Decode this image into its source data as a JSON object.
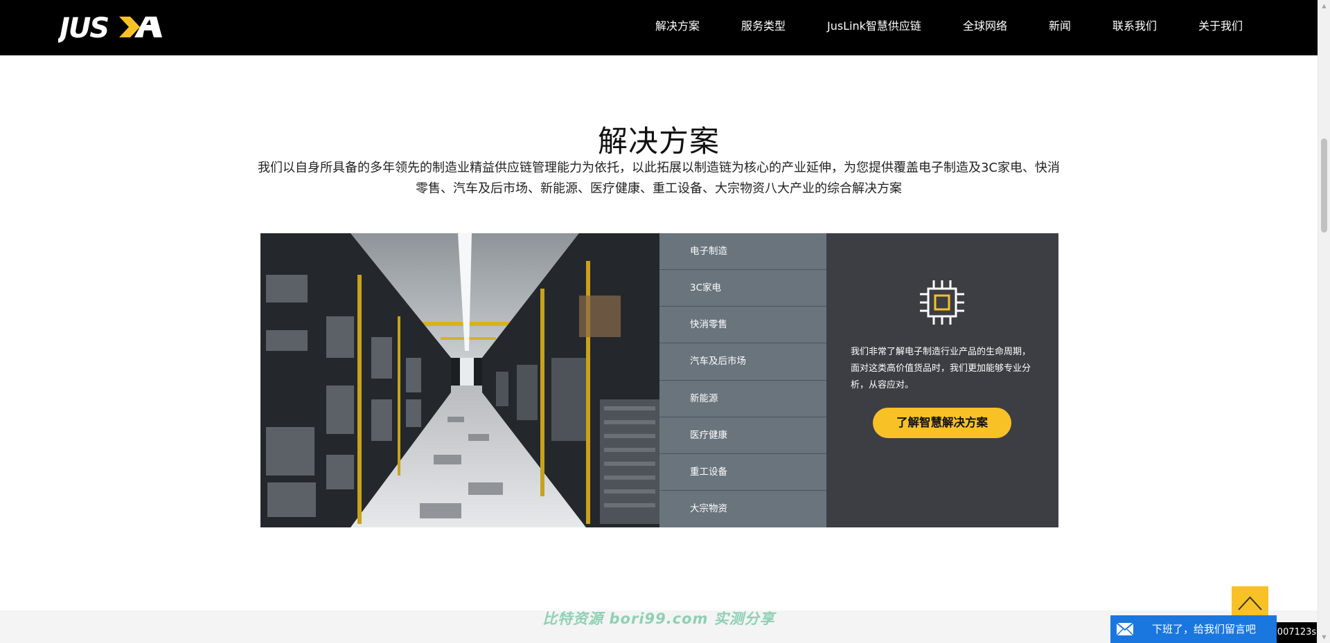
{
  "header": {
    "logo_text": "JUSDA",
    "nav": [
      "解决方案",
      "服务类型",
      "JusLink智慧供应链",
      "全球网络",
      "新闻",
      "联系我们",
      "关于我们"
    ]
  },
  "section": {
    "title": "解决方案",
    "description": "我们以自身所具备的多年领先的制造业精益供应链管理能力为依托，以此拓展以制造链为核心的产业延伸，为您提供覆盖电子制造及3C家电、快消零售、汽车及后市场、新能源、医疗健康、重工设备、大宗物资八大产业的综合解决方案"
  },
  "solutions": {
    "menu": [
      "电子制造",
      "3C家电",
      "快消零售",
      "汽车及后市场",
      "新能源",
      "医疗健康",
      "重工设备",
      "大宗物资"
    ],
    "detail_text": "我们非常了解电子制造行业产品的生命周期，面对这类高价值货品时，我们更加能够专业分析，从容应对。",
    "cta_label": "了解智慧解决方案",
    "icon": "chip-icon"
  },
  "footer": {
    "watermark": "比特资源 bori99.com 实测分享",
    "chat_label": "下班了，给我们留言吧",
    "timer": "007123s"
  },
  "colors": {
    "accent": "#f8c226",
    "menu_bg": "#6a747d",
    "detail_bg": "#3c3e44",
    "chat_blue": "#1a77e0"
  }
}
